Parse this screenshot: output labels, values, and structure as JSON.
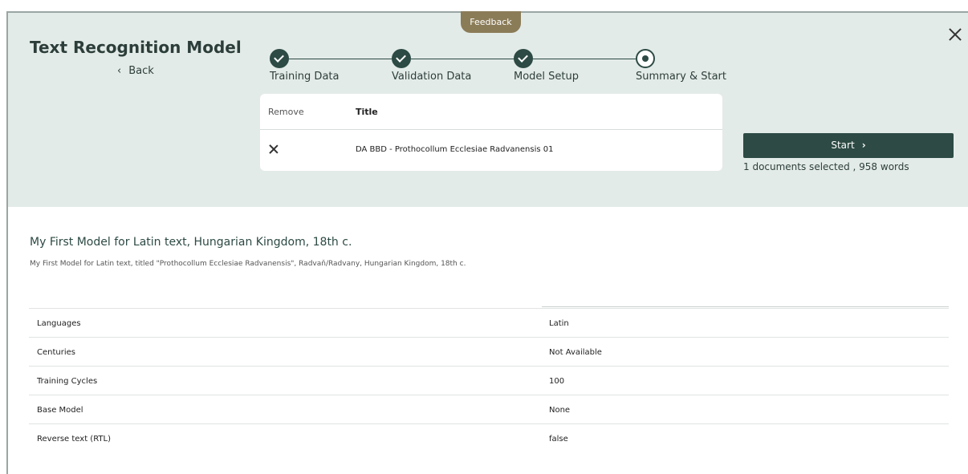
{
  "feedback_label": "Feedback",
  "header": {
    "title": "Text Recognition Model",
    "back_label": "Back"
  },
  "steps": [
    {
      "label": "Training Data",
      "state": "done"
    },
    {
      "label": "Validation Data",
      "state": "done"
    },
    {
      "label": "Model Setup",
      "state": "done"
    },
    {
      "label": "Summary & Start",
      "state": "current"
    }
  ],
  "documents": {
    "columns": [
      "Remove",
      "Title"
    ],
    "rows": [
      {
        "title": "DA BBD - Prothocollum Ecclesiae Radvanensis 01"
      }
    ]
  },
  "start_button": {
    "label": "Start"
  },
  "selected_info": "1 documents selected , 958 words",
  "model": {
    "name": "My First Model for Latin text, Hungarian Kingdom, 18th c.",
    "description": "My First Model for Latin text, titled \"Prothocollum Ecclesiae Radvanensis\", Radvaň/Radvany, Hungarian Kingdom, 18th c."
  },
  "properties": [
    {
      "key": "Languages",
      "value": "Latin"
    },
    {
      "key": "Centuries",
      "value": "Not Available"
    },
    {
      "key": "Training Cycles",
      "value": "100"
    },
    {
      "key": "Base Model",
      "value": "None"
    },
    {
      "key": "Reverse text (RTL)",
      "value": "false"
    }
  ],
  "colors": {
    "header_bg": "#e3ebe8",
    "accent": "#2d4a44",
    "feedback": "#8b7c58"
  }
}
